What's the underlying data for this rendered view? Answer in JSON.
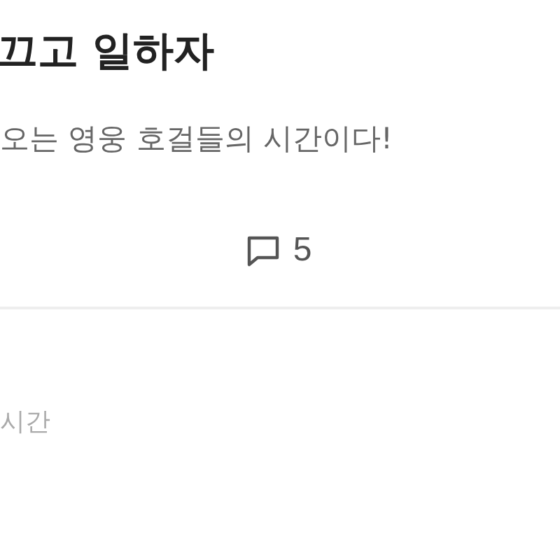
{
  "post": {
    "title": "끄고 일하자",
    "subtitle": "오는 영웅 호걸들의 시간이다!",
    "comment_count": "5"
  },
  "next_post": {
    "meta": "시간"
  }
}
